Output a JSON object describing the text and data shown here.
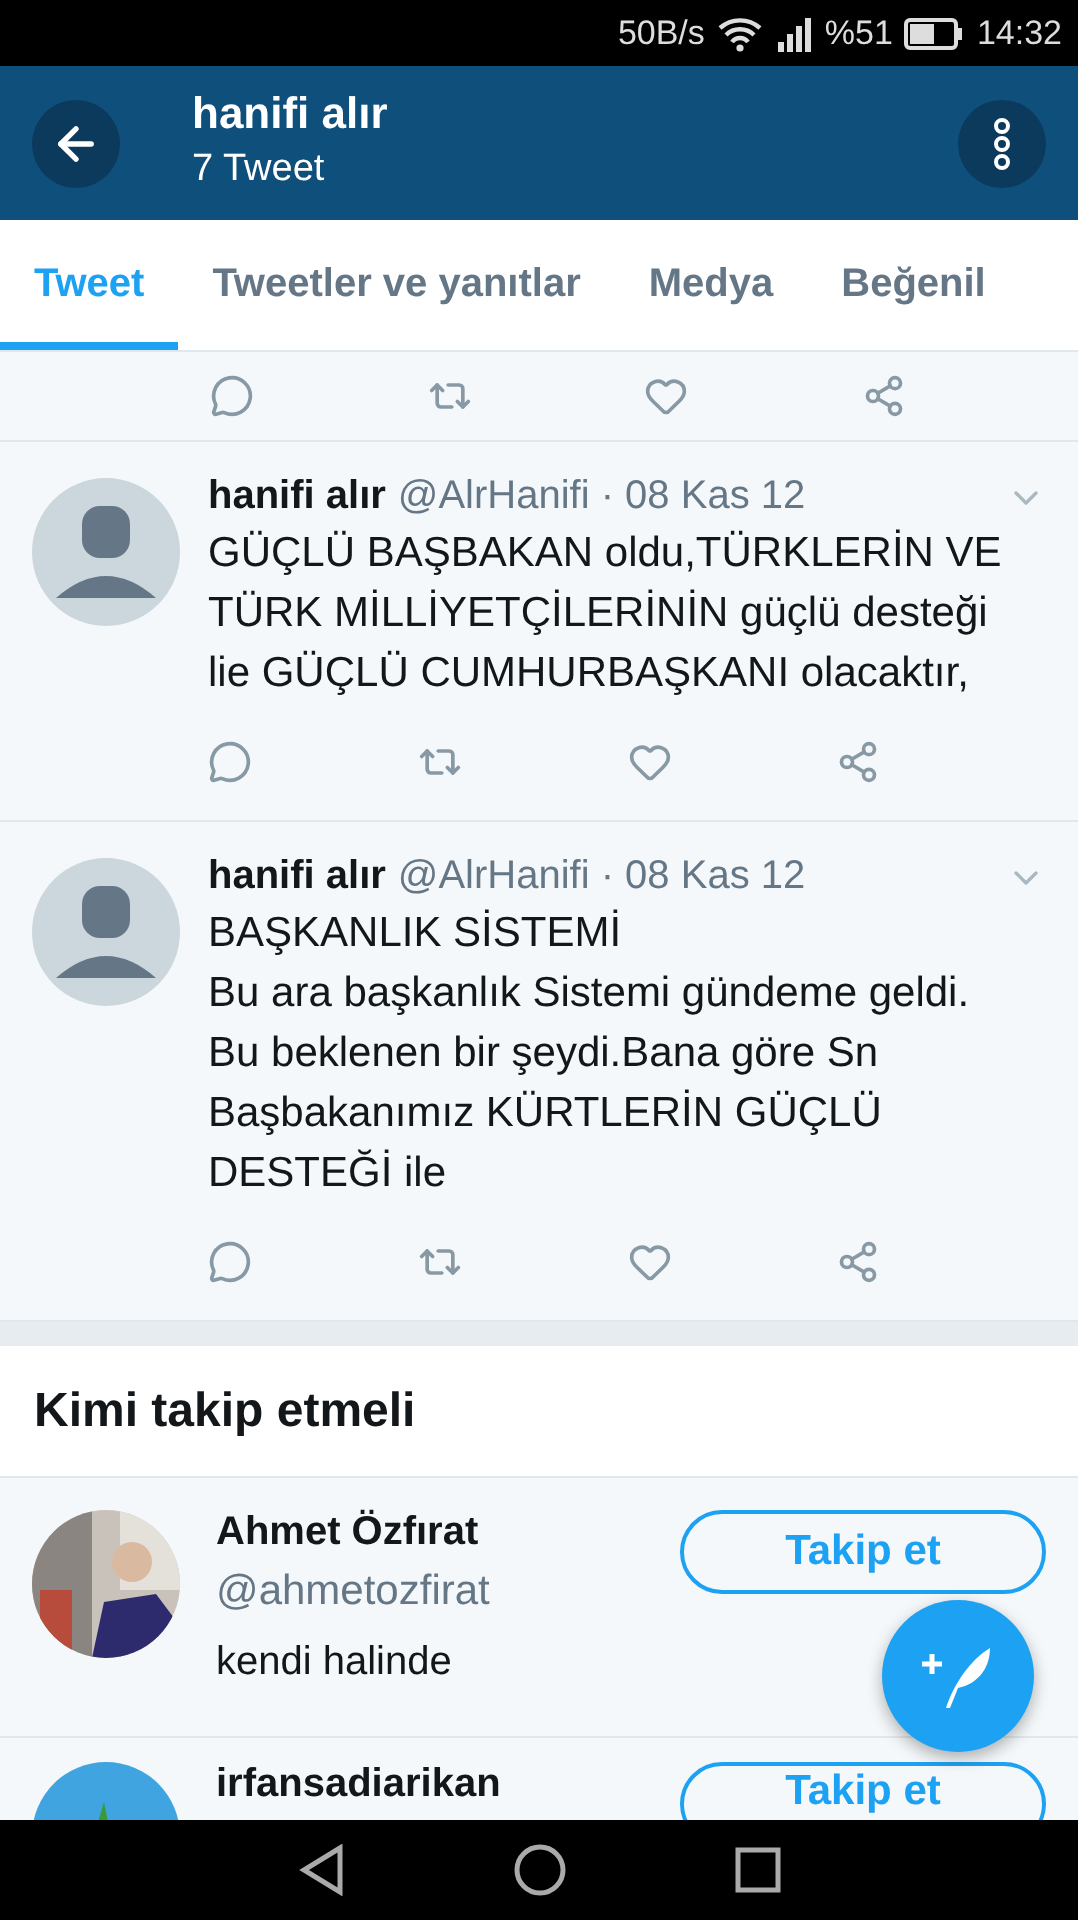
{
  "status_bar": {
    "speed": "50B/s",
    "battery": "%51",
    "time": "14:32"
  },
  "header": {
    "title": "hanifi alır",
    "subtitle": "7 Tweet"
  },
  "tabs": [
    {
      "label": "Tweet",
      "selected": true
    },
    {
      "label": "Tweetler ve yanıtlar",
      "selected": false
    },
    {
      "label": "Medya",
      "selected": false
    },
    {
      "label": "Beğenil",
      "selected": false
    }
  ],
  "tweets": [
    {
      "kind": "clipped"
    },
    {
      "kind": "full",
      "name": "hanifi alır",
      "meta": "@AlrHanifi · 08 Kas 12",
      "text": "GÜÇLÜ BAŞBAKAN oldu,TÜRKLERİN VE TÜRK MİLLİYETÇİLERİNİN güçlü desteği lie GÜÇLÜ CUMHURBAŞKANI olacaktır,"
    },
    {
      "kind": "full",
      "name": "hanifi alır",
      "meta": "@AlrHanifi · 08 Kas 12",
      "text": "BAŞKANLIK SİSTEMİ\nBu ara başkanlık Sistemi gündeme geldi. Bu beklenen bir şeydi.Bana göre Sn Başbakanımız KÜRTLERİN GÜÇLÜ DESTEĞİ ile"
    }
  ],
  "suggestions": {
    "title": "Kimi takip etmeli",
    "people": [
      {
        "kind": "full",
        "name": "Ahmet Özfırat",
        "handle": "@ahmetozfirat",
        "bio": "kendi halinde",
        "button": "Takip et"
      },
      {
        "kind": "clipped",
        "name": "irfansadiarikan",
        "button": "Takip et"
      }
    ]
  }
}
